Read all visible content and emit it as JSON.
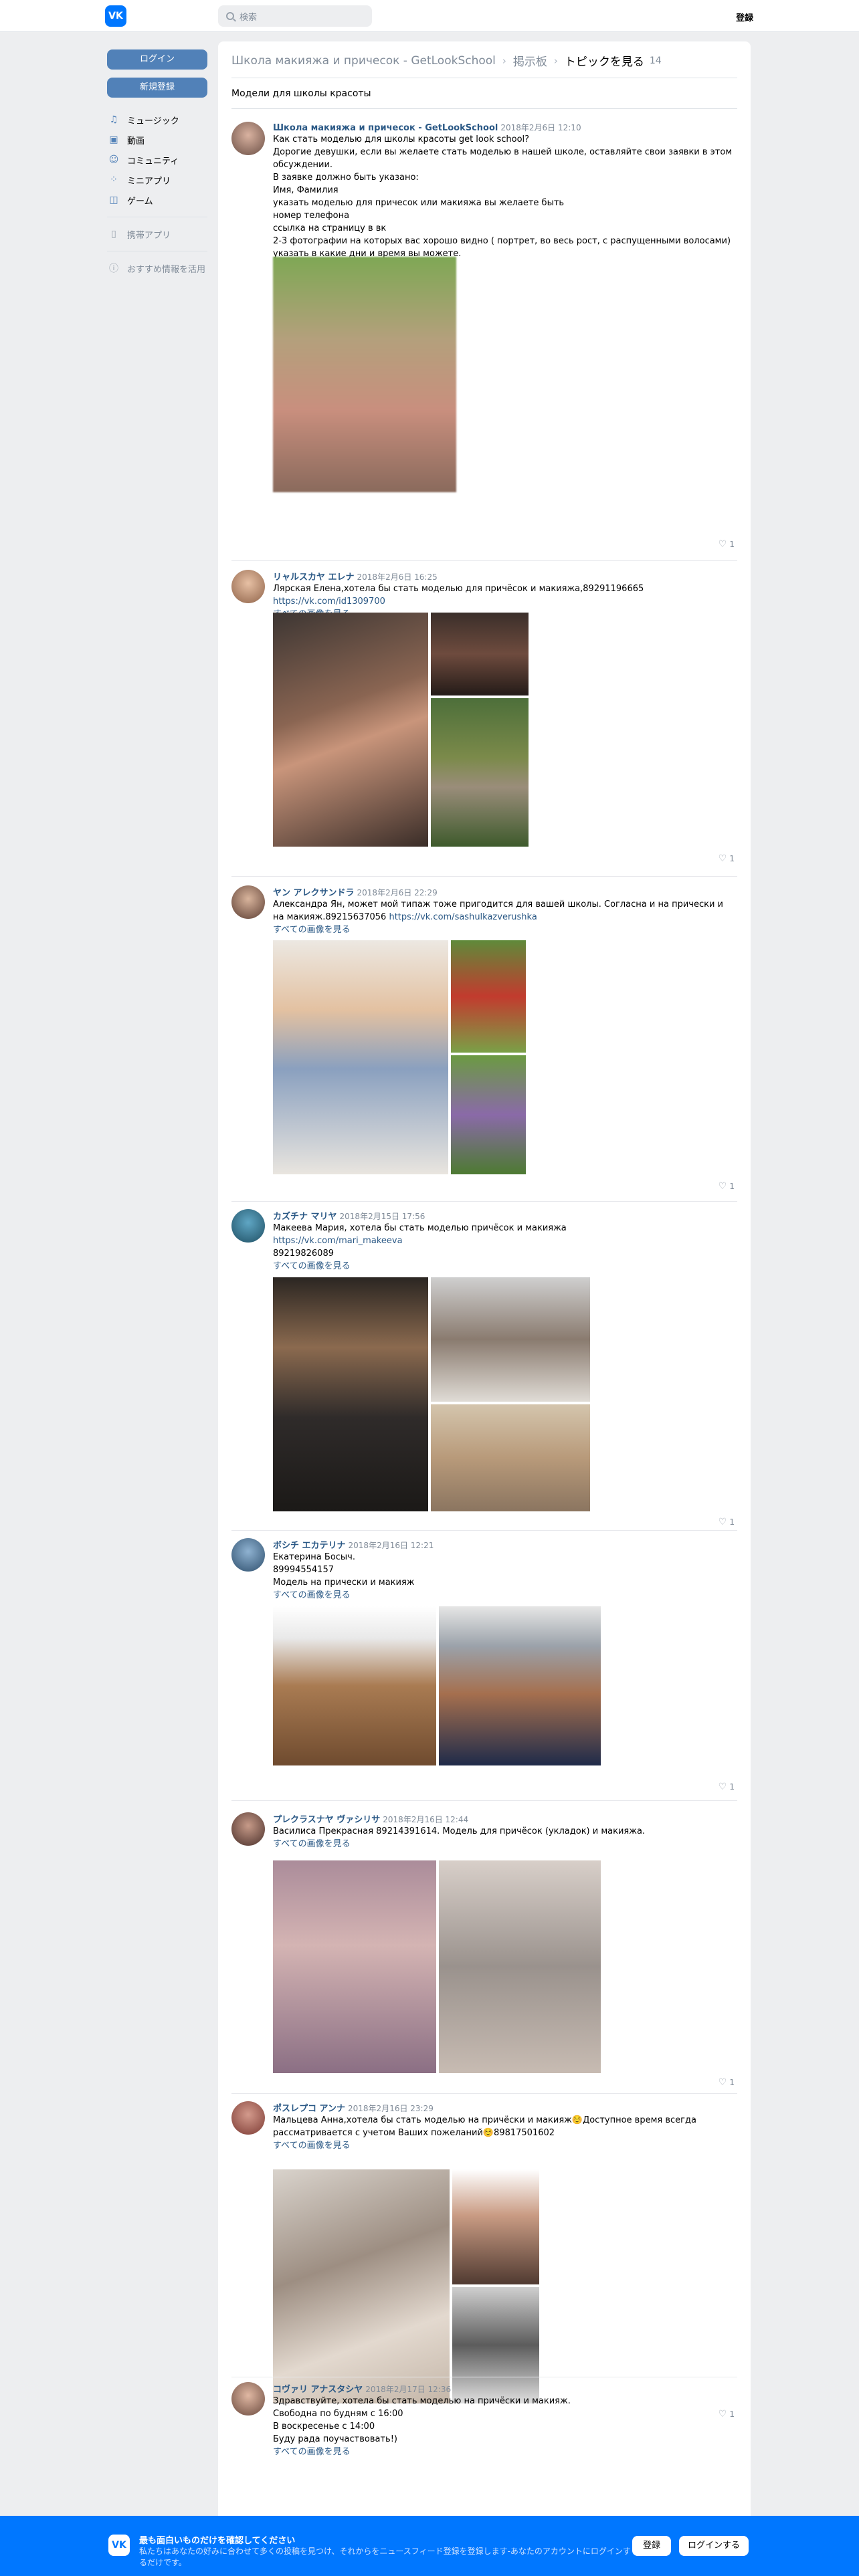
{
  "header": {
    "logo": "VK",
    "search_placeholder": "検索",
    "register": "登録"
  },
  "sidebar": {
    "login": "ログイン",
    "signup": "新規登録",
    "items": [
      {
        "icon": "music-icon",
        "label": "ミュージック"
      },
      {
        "icon": "video-icon",
        "label": "動画"
      },
      {
        "icon": "community-icon",
        "label": "コミュニティ"
      },
      {
        "icon": "miniapps-icon",
        "label": "ミニアプリ"
      },
      {
        "icon": "games-icon",
        "label": "ゲーム"
      }
    ],
    "mobile_app": " 携帯アプリ",
    "blocked": "おすすめ情報を活用"
  },
  "breadcrumb": {
    "group": "Школа макияжа и причесок - GetLookSchool",
    "board": "掲示板",
    "current": "トピックを見る",
    "count": "14"
  },
  "topic": {
    "title": "Модели для школы красоты"
  },
  "see_all": "すべての画像を見る",
  "posts": [
    {
      "author": "Школа макияжа и причесок - GetLookSchool",
      "date": "2018年2月6日 12:10",
      "text": "Как стать моделью для школы красоты get look school?\nДорогие девушки, если вы желаете стать моделью в нашей школе, оставляйте свои заявки в этом обсуждении.\nВ заявке должно быть указано:\nИмя, Фамилия\nуказать моделью для причесок или макияжа вы желаете быть\nномер телефона\nссылка на страницу в вк\n2-3 фотографии на которых вас хорошо видно ( портрет, во весь рост, с распущенными волосами)\nуказать в какие дни и время вы можете.",
      "likes": "1"
    },
    {
      "author": "リャルスカヤ エレナ",
      "date": "2018年2月6日 16:25",
      "text": "Лярская Елена,хотела бы стать моделью для причёсок и макияжа,89291196665",
      "link": "https://vk.com/id1309700",
      "likes": "1"
    },
    {
      "author": "ヤン アレクサンドラ",
      "date": "2018年2月6日 22:29",
      "text": "Александра Ян, может мой типаж тоже пригодится для вашей школы. Согласна и на прически и на макияж.89215637056",
      "link": "https://vk.com/sashulkazverushka",
      "likes": "1"
    },
    {
      "author": "カズチナ マリヤ",
      "date": "2018年2月15日 17:56",
      "text": "Макеева Мария, хотела бы стать моделью причёсок и макияжа",
      "link": "https://vk.com/mari_makeeva",
      "text2": "89219826089",
      "likes": "1"
    },
    {
      "author": "ボシチ エカテリナ",
      "date": "2018年2月16日 12:21",
      "text": "Екатерина Босыч.\n89994554157\nМодель на прически и макияж",
      "likes": "1"
    },
    {
      "author": "プレクラスナヤ ヴァシリサ",
      "date": "2018年2月16日 12:44",
      "text": "Василиса Прекрасная 89214391614. Модель для причёсок (укладок) и макияжа.",
      "likes": "1"
    },
    {
      "author": "ポスレプコ アンナ",
      "date": "2018年2月16日 23:29",
      "text": "Мальцева Анна,хотела бы стать моделью на причёски и макияж☺️Доступное время всегда рассматривается с учетом Ваших пожеланий☺️89817501602",
      "likes": "1"
    },
    {
      "author": "コヴァリ アナスタシヤ",
      "date": "2018年2月17日 12:36",
      "text": "Здравствуйте, хотела бы стать моделью на причёски и макияж.\nСвободна по будням с 16:00\nВ воскресенье с 14:00\nБуду рада поучаствовать!)"
    }
  ],
  "bottom_bar": {
    "title": "最も面白いものだけを確認してください",
    "subtitle": "私たちはあなたの好みに合わせて多くの投稿を見つけ、それからをニュースフィード登録を登録します-あなたのアカウントにログインするだけです。",
    "register": "登録",
    "login": "ログインする"
  },
  "colors": {
    "accent": "#0077ff",
    "link": "#2a5885",
    "button": "#5181b8"
  }
}
